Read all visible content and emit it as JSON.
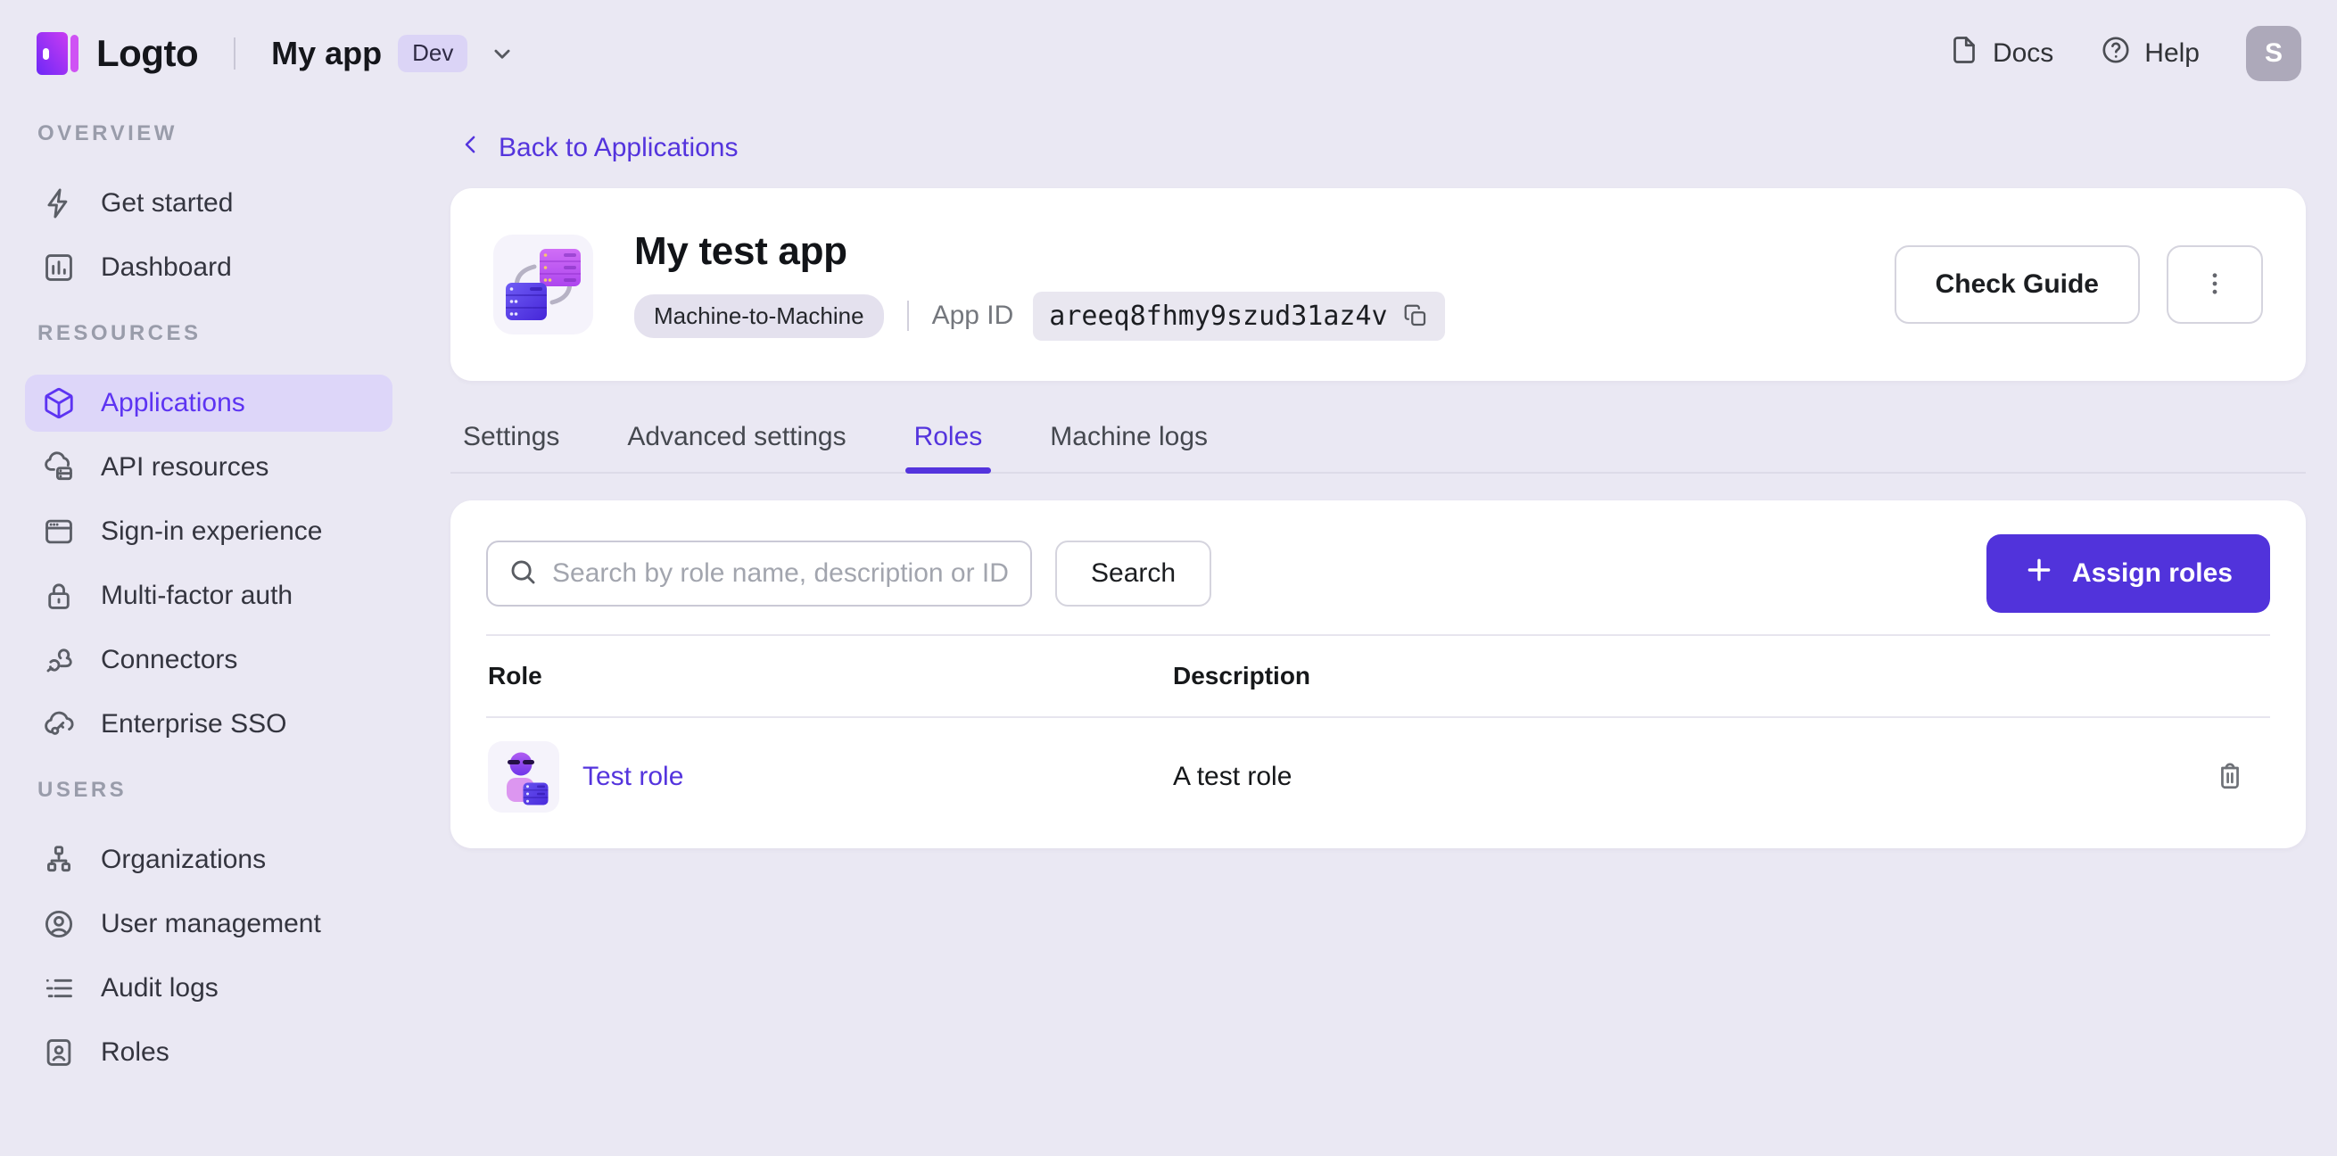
{
  "topbar": {
    "brand": "Logto",
    "project_name": "My app",
    "env_badge": "Dev",
    "docs_label": "Docs",
    "help_label": "Help",
    "avatar_initial": "S"
  },
  "sidebar": {
    "sections": [
      {
        "label": "OVERVIEW",
        "items": [
          {
            "label": "Get started",
            "icon": "lightning-icon"
          },
          {
            "label": "Dashboard",
            "icon": "bar-chart-icon"
          }
        ]
      },
      {
        "label": "RESOURCES",
        "items": [
          {
            "label": "Applications",
            "icon": "cube-icon",
            "active": true
          },
          {
            "label": "API resources",
            "icon": "cloud-box-icon"
          },
          {
            "label": "Sign-in experience",
            "icon": "browser-icon"
          },
          {
            "label": "Multi-factor auth",
            "icon": "lock-icon"
          },
          {
            "label": "Connectors",
            "icon": "connectors-icon"
          },
          {
            "label": "Enterprise SSO",
            "icon": "cloud-key-icon"
          }
        ]
      },
      {
        "label": "USERS",
        "items": [
          {
            "label": "Organizations",
            "icon": "org-chart-icon"
          },
          {
            "label": "User management",
            "icon": "user-circle-icon"
          },
          {
            "label": "Audit logs",
            "icon": "list-icon"
          },
          {
            "label": "Roles",
            "icon": "id-card-icon"
          }
        ]
      }
    ]
  },
  "main": {
    "back_link": "Back to Applications",
    "app": {
      "title": "My test app",
      "type_badge": "Machine-to-Machine",
      "app_id_label": "App ID",
      "app_id": "areeq8fhmy9szud31az4v"
    },
    "actions": {
      "check_guide": "Check Guide"
    },
    "tabs": [
      {
        "label": "Settings"
      },
      {
        "label": "Advanced settings"
      },
      {
        "label": "Roles",
        "active": true
      },
      {
        "label": "Machine logs"
      }
    ],
    "roles_panel": {
      "search_placeholder": "Search by role name, description or ID",
      "search_value": "",
      "search_button": "Search",
      "assign_button": "Assign roles",
      "table": {
        "columns": {
          "role": "Role",
          "description": "Description"
        },
        "rows": [
          {
            "role": "Test role",
            "description": "A test role"
          }
        ]
      }
    }
  },
  "colors": {
    "accent": "#5133db",
    "accent_bright": "#5d34f2",
    "active_pill_bg": "#ddd6f9",
    "page_bg": "#eae8f3",
    "card_bg": "#ffffff"
  }
}
